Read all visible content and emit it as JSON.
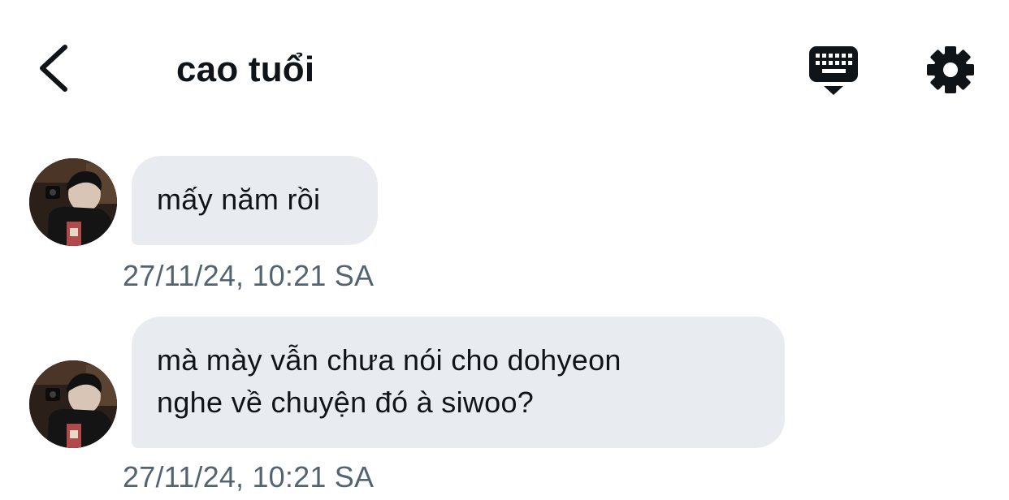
{
  "header": {
    "title": "cao tuổi",
    "back_icon": "chevron-left-icon",
    "keyboard_icon": "keyboard-icon",
    "settings_icon": "gear-icon"
  },
  "messages": [
    {
      "lines": [
        "mấy năm rồi"
      ],
      "timestamp": "27/11/24, 10:21 SA"
    },
    {
      "lines": [
        "mà mày vẫn chưa nói cho dohyeon",
        "nghe về chuyện đó à siwoo?"
      ],
      "timestamp": "27/11/24, 10:21 SA"
    }
  ],
  "colors": {
    "bubble_background": "#e8ecf0",
    "timestamp_text": "#536471",
    "primary_text": "#0f1419"
  }
}
